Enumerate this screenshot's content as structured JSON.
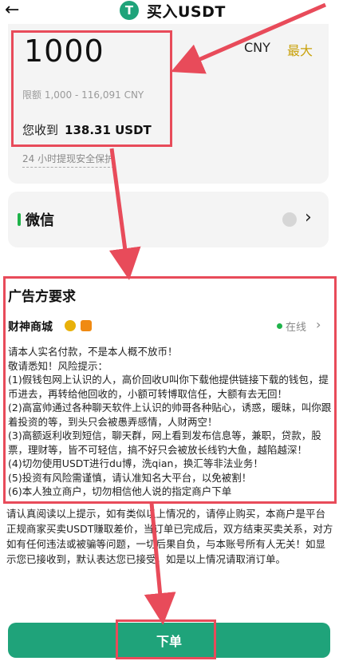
{
  "header": {
    "back_icon": "arrow-left-icon",
    "coin_icon_letter": "T",
    "title": "买入USDT"
  },
  "amount": {
    "value": "1000",
    "currency": "CNY",
    "max_label": "最大",
    "limit": "限额 1,000 - 116,091 CNY",
    "receive_label": "您收到",
    "receive_value": "138.31 USDT",
    "protection": "24 小时提现安全保护"
  },
  "payment": {
    "method": "微信",
    "chevron_icon": "chevron-right-icon"
  },
  "requirements": {
    "title": "广告方要求",
    "merchant": "财神商城",
    "status": "在线",
    "status_color": "#1fb34a",
    "lines": [
      "请本人实名付款，不是本人概不放币！",
      "敬请悉知！风险提示：",
      "(1)假钱包网上认识的人，高价回收U叫你下载他提供链接下载的钱包，提币进去，再转给他回收的，小额可转博取信任，大额有去无回！",
      "(2)高富帅通过各种聊天软件上认识的帅哥各种贴心，诱惑，暖昧，叫你跟着投资的等，到头只会被愚弄感情，人财两空！",
      "(3)高额返利收到短信，聊天群，网上看到发布信息等，兼职，贷款，股票，理财等，皆不可轻信，搞不好只会被放长线钓大鱼，越陷越深！",
      "(4)切勿使用USDT进行du博，洗qian，换汇等非法业务！",
      "(5)投资有风险需谨慎，请认准知名大平台，以免被割！",
      "(6)本人独立商户，切勿相信他人说的指定商户下单"
    ]
  },
  "notice": "请认真阅读以上提示，如有类似以上情况的，请停止购买，本商户是平台正规商家买卖USDT赚取差价，当订单已完成后，双方结束买卖关系，对方如有任何违法或被骗等问题，一切后果自负，与本账号所有人无关！如显示您已接收到，默认表达您已接受，如是以上情况请取消订单。",
  "order_button": "下单",
  "colors": {
    "accent": "#1fa37a",
    "max_label": "#c9a20c",
    "annotation": "#e84b5a"
  }
}
